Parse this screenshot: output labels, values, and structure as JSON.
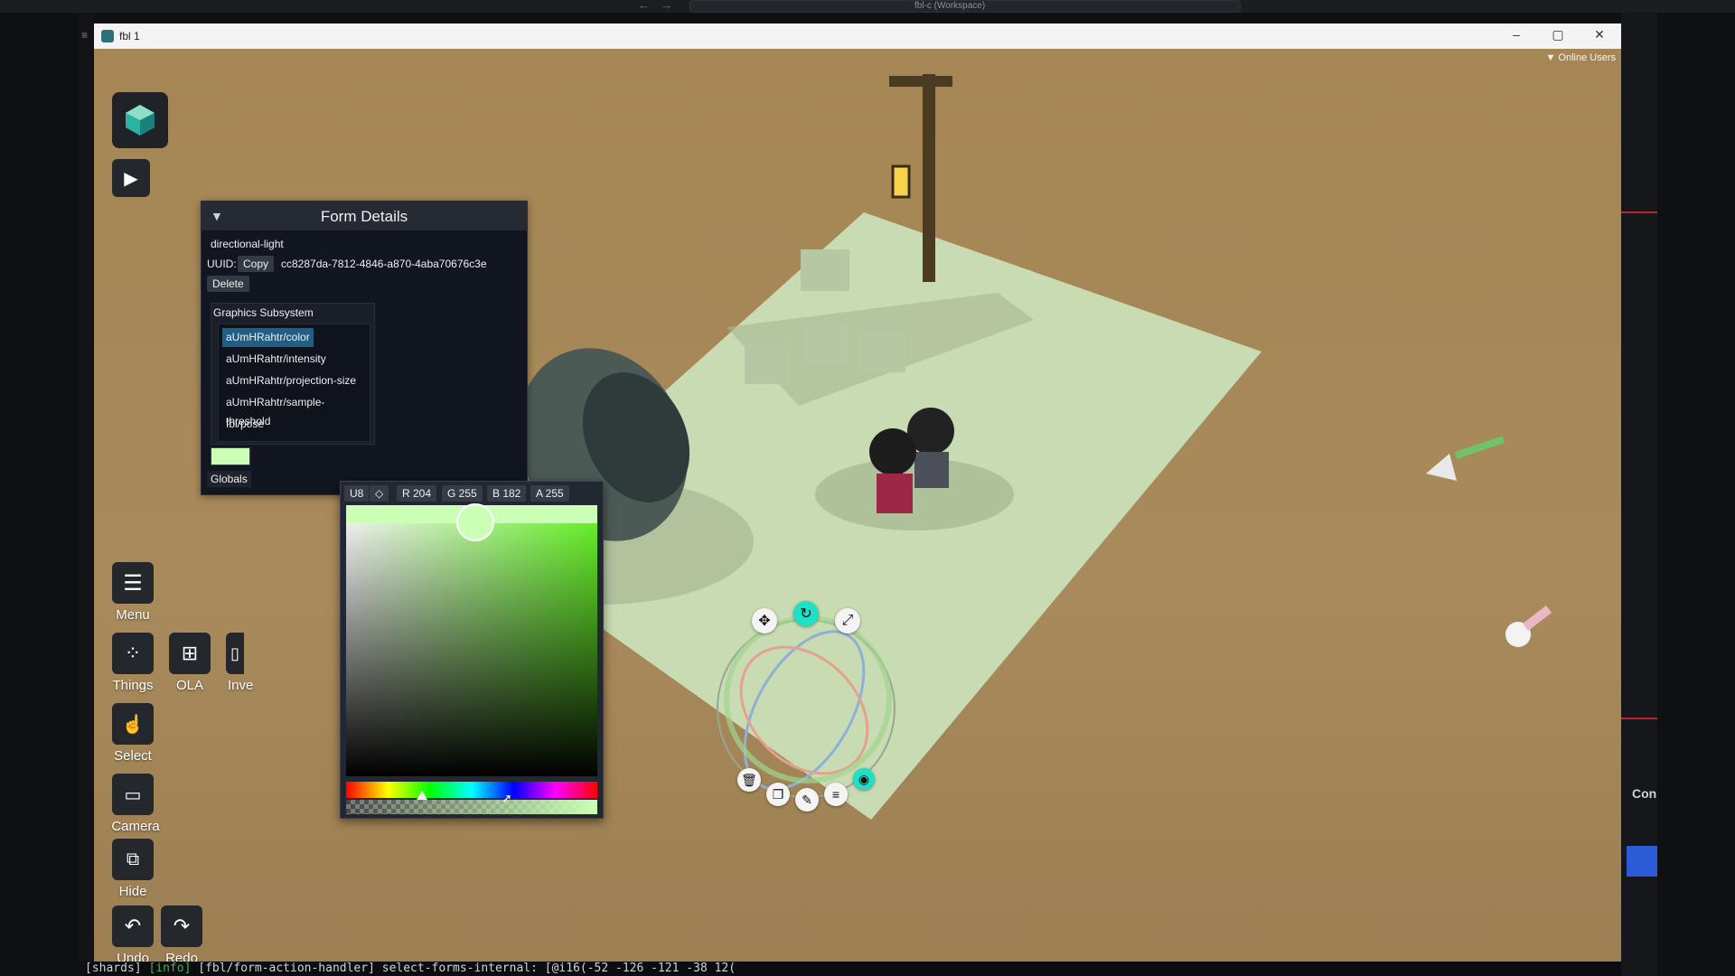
{
  "os": {
    "workspace_search": "fbl-c (Workspace)",
    "nav_back": "←",
    "nav_forward": "→",
    "status_line": {
      "tag": "[shards]",
      "level": "[info]",
      "message": "[fbl/form-action-handler] select-forms-internal: [@i16(-52 -126 -121 -38 12("
    },
    "right_panel_label": "Con"
  },
  "window": {
    "title": "fbl 1",
    "minimize": "–",
    "maximize": "▢",
    "close": "✕"
  },
  "viewport": {
    "online_users": "Online Users"
  },
  "toolbar": {
    "play_icon": "play-icon",
    "items": [
      {
        "label": "Menu",
        "icon": "hamburger-icon"
      },
      {
        "label": "Things",
        "icon": "grid-circles-icon"
      },
      {
        "label": "OLA",
        "icon": "grid-squares-icon"
      },
      {
        "label": "Inve",
        "icon": "inventory-icon"
      },
      {
        "label": "Select",
        "icon": "select-hand-icon"
      },
      {
        "label": "Camera",
        "icon": "video-camera-icon"
      },
      {
        "label": "Hide",
        "icon": "hide-icon"
      },
      {
        "label": "Undo",
        "icon": "undo-icon"
      },
      {
        "label": "Redo",
        "icon": "redo-icon"
      }
    ]
  },
  "form_details": {
    "title": "Form Details",
    "name": "directional-light",
    "uuid_label": "UUID:",
    "copy_label": "Copy",
    "uuid": "cc8287da-7812-4846-a870-4aba70676c3e",
    "delete_label": "Delete",
    "section_title": "Graphics Subsystem",
    "properties": [
      "aUmHRahtr/color",
      "aUmHRahtr/intensity",
      "aUmHRahtr/projection-size",
      "aUmHRahtr/sample-threshold",
      "fbl/pose"
    ],
    "selected_index": 0,
    "globals_label": "Globals"
  },
  "color_picker": {
    "mode": "U8",
    "eyedropper_icon": "eyedropper-icon",
    "r": "R 204",
    "g": "G 255",
    "b": "B 182",
    "a": "A 255",
    "color_hex": "#ccffb6",
    "hue_position_fraction": 0.29,
    "alpha_fraction": 1.0
  },
  "gizmo": {
    "move_icon": "move-arrows-icon",
    "rotate_icon": "rotate-icon",
    "scale_icon": "scale-arrow-icon",
    "delete_icon": "trash-icon",
    "duplicate_icon": "copy-icon",
    "edit_icon": "pencil-icon",
    "menu_icon": "menu-lines-icon",
    "focus_icon": "target-icon"
  },
  "colors": {
    "ground_plane": "#c9dbb2",
    "background": "#a98a5c",
    "accent_cyan": "#1de1c4"
  }
}
